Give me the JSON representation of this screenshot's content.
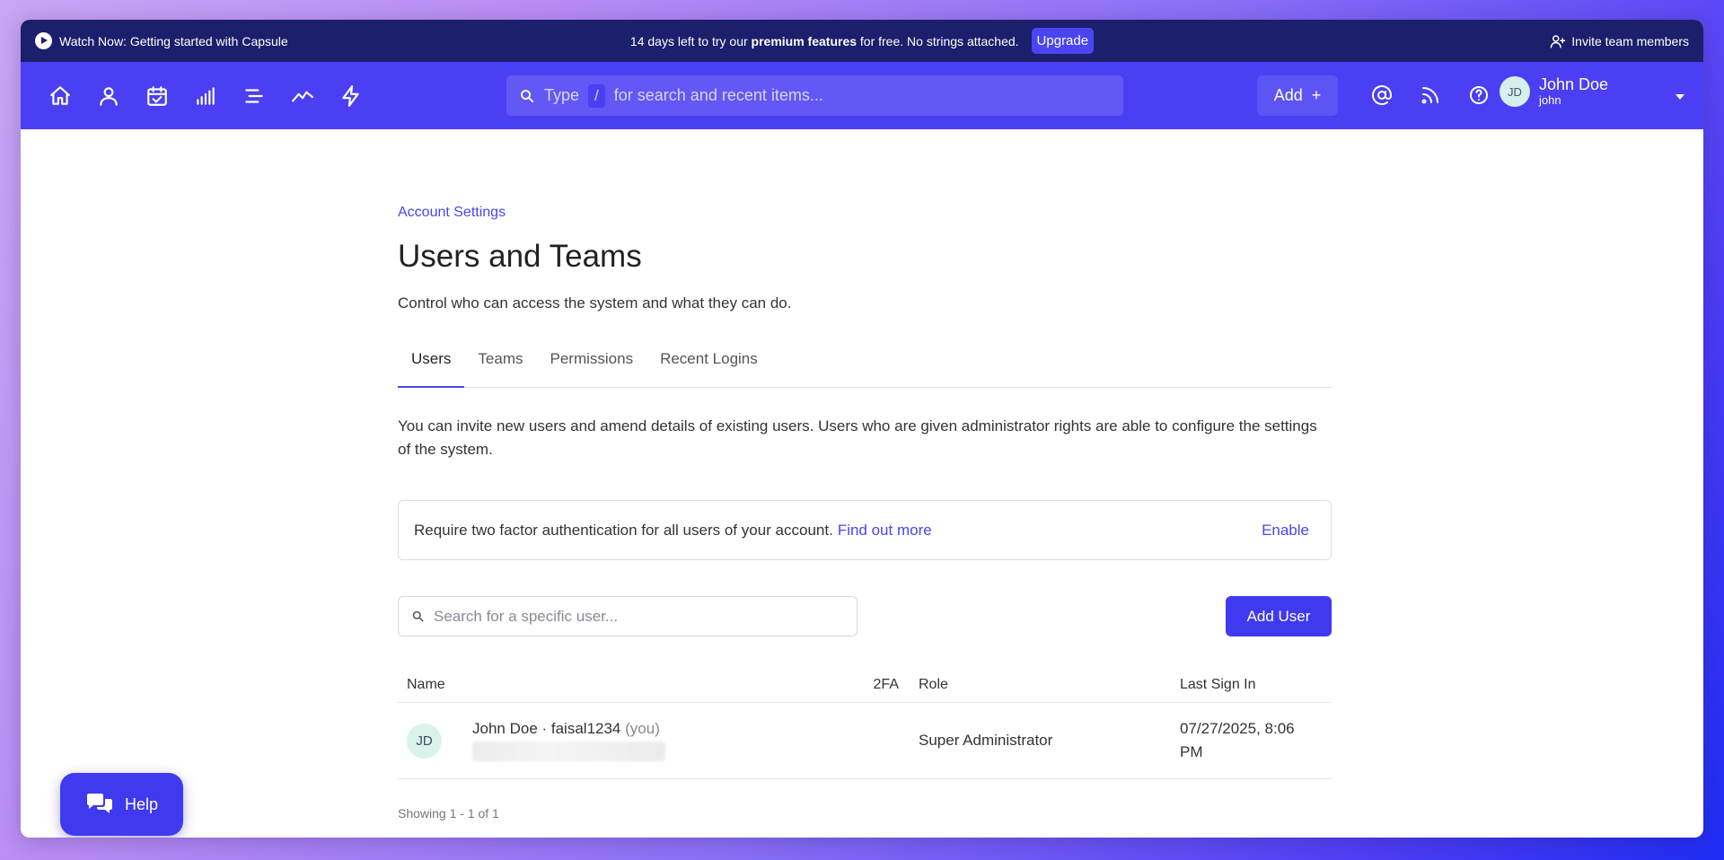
{
  "promo": {
    "watch_text": "Watch Now: Getting started with Capsule",
    "trial_prefix": "14 days left to try our",
    "trial_bold": "premium features",
    "trial_suffix": "for free. No strings attached.",
    "upgrade_label": "Upgrade",
    "invite_label": "Invite team members"
  },
  "nav": {
    "icons": [
      "home-icon",
      "person-icon",
      "calendar-check-icon",
      "bar-chart-icon",
      "list-icon",
      "trend-line-icon",
      "lightning-icon"
    ],
    "search_prefix": "Type",
    "search_key": "/",
    "search_suffix": "for search and recent items...",
    "add_label": "Add",
    "add_symbol": "+",
    "right_icons": [
      "at-sign-icon",
      "rss-feed-icon",
      "help-circle-icon"
    ],
    "user_initials": "JD",
    "user_name": "John Doe",
    "user_handle": "john"
  },
  "main": {
    "breadcrumb": "Account Settings",
    "title": "Users and Teams",
    "subtitle": "Control who can access the system and what they can do.",
    "tabs": [
      {
        "label": "Users",
        "active": true
      },
      {
        "label": "Teams",
        "active": false
      },
      {
        "label": "Permissions",
        "active": false
      },
      {
        "label": "Recent Logins",
        "active": false
      }
    ],
    "description": "You can invite new users and amend details of existing users. Users who are given administrator rights are able to configure the settings of the system.",
    "tfa": {
      "text": "Require two factor authentication for all users of your account.",
      "link": "Find out more",
      "action": "Enable"
    },
    "search_placeholder": "Search for a specific user...",
    "add_user_label": "Add User",
    "table": {
      "headers": {
        "name": "Name",
        "twofa": "2FA",
        "role": "Role",
        "last_sign_in": "Last Sign In"
      },
      "rows": [
        {
          "initials": "JD",
          "name": "John Doe · faisal1234",
          "you": "(you)",
          "twofa": "",
          "role": "Super Administrator",
          "last_sign_in_line1": "07/27/2025, 8:06",
          "last_sign_in_line2": "PM"
        }
      ]
    },
    "showing": "Showing 1 - 1 of 1"
  },
  "help": {
    "label": "Help"
  },
  "colors": {
    "accent": "#4a3ff2",
    "banner": "#1c1f6b",
    "button": "#3f3aef"
  }
}
